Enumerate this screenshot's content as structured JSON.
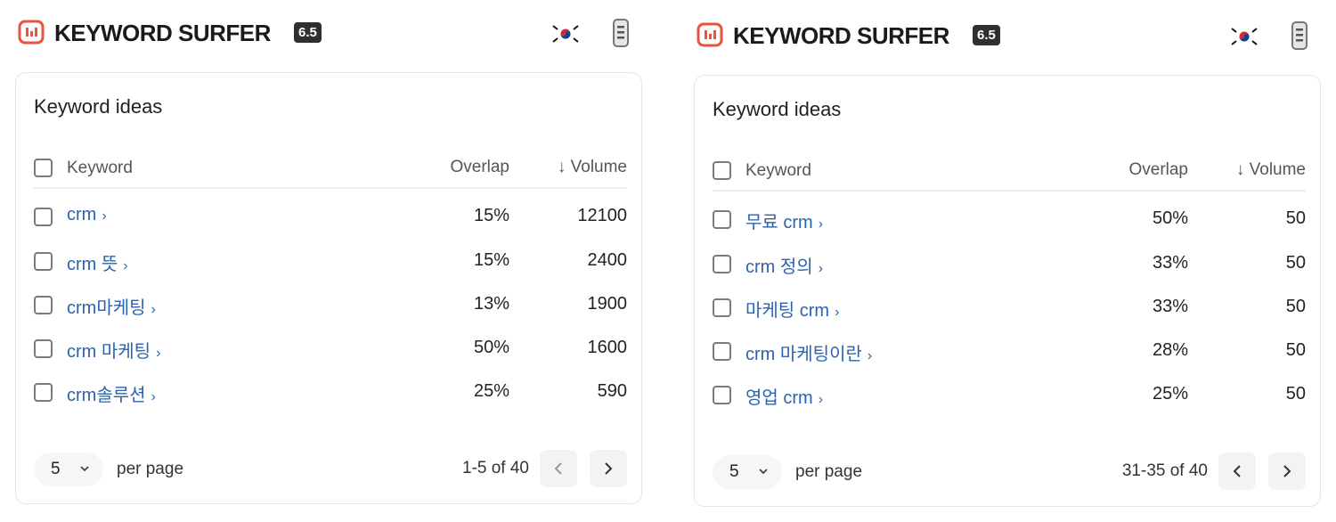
{
  "colors": {
    "brand": "#e8543f",
    "link": "#2c63b0",
    "badge": "#2f2f2f"
  },
  "panels": [
    {
      "brand": "KEYWORD SURFER",
      "version": "6.5",
      "card_title": "Keyword ideas",
      "columns": {
        "keyword": "Keyword",
        "overlap": "Overlap",
        "volume": "↓ Volume"
      },
      "rows": [
        {
          "keyword": "crm",
          "overlap": "15%",
          "volume": "12100"
        },
        {
          "keyword": "crm 뜻",
          "overlap": "15%",
          "volume": "2400"
        },
        {
          "keyword": "crm마케팅",
          "overlap": "13%",
          "volume": "1900"
        },
        {
          "keyword": "crm 마케팅",
          "overlap": "50%",
          "volume": "1600"
        },
        {
          "keyword": "crm솔루션",
          "overlap": "25%",
          "volume": "590"
        }
      ],
      "per_page_value": "5",
      "per_page_label": "per page",
      "range": "1-5 of 40"
    },
    {
      "brand": "KEYWORD SURFER",
      "version": "6.5",
      "card_title": "Keyword ideas",
      "columns": {
        "keyword": "Keyword",
        "overlap": "Overlap",
        "volume": "↓ Volume"
      },
      "rows": [
        {
          "keyword": "무료 crm",
          "overlap": "50%",
          "volume": "50"
        },
        {
          "keyword": "crm 정의",
          "overlap": "33%",
          "volume": "50"
        },
        {
          "keyword": "마케팅 crm",
          "overlap": "33%",
          "volume": "50"
        },
        {
          "keyword": "crm 마케팅이란",
          "overlap": "28%",
          "volume": "50"
        },
        {
          "keyword": "영업 crm",
          "overlap": "25%",
          "volume": "50"
        }
      ],
      "per_page_value": "5",
      "per_page_label": "per page",
      "range": "31-35 of 40"
    }
  ]
}
